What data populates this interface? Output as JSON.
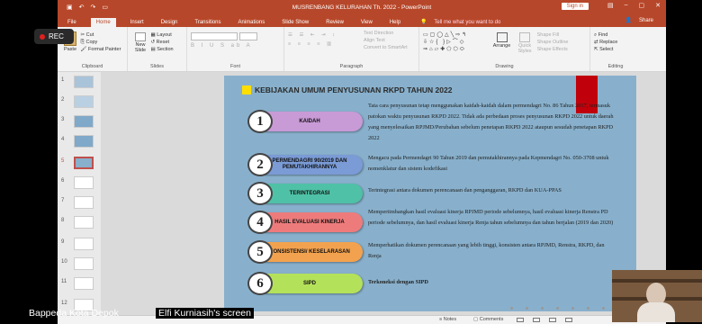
{
  "recording": {
    "label": "REC"
  },
  "titlebar": {
    "title": "MUSRENBANG KELURAHAN Th. 2022  -  PowerPoint",
    "signin": "Sign in"
  },
  "tabs": [
    "File",
    "Home",
    "Insert",
    "Design",
    "Transitions",
    "Animations",
    "Slide Show",
    "Review",
    "View",
    "Help"
  ],
  "tell_me": "Tell me what you want to do",
  "share": "Share",
  "ribbon": {
    "clipboard": {
      "label": "Clipboard",
      "paste": "Paste",
      "cut": "Cut",
      "copy": "Copy",
      "format_painter": "Format Painter"
    },
    "slides": {
      "label": "Slides",
      "new_slide": "New Slide",
      "layout": "Layout",
      "reset": "Reset",
      "section": "Section"
    },
    "font": {
      "label": "Font"
    },
    "paragraph": {
      "label": "Paragraph",
      "text_direction": "Text Direction",
      "align_text": "Align Text",
      "convert": "Convert to SmartArt"
    },
    "drawing": {
      "label": "Drawing",
      "arrange": "Arrange",
      "quick_styles": "Quick Styles",
      "shape_fill": "Shape Fill",
      "shape_outline": "Shape Outline",
      "shape_effects": "Shape Effects"
    },
    "editing": {
      "label": "Editing",
      "find": "Find",
      "replace": "Replace",
      "select": "Select"
    }
  },
  "thumbnails": [
    "1",
    "2",
    "3",
    "4",
    "5",
    "6",
    "7",
    "8",
    "9",
    "10",
    "11",
    "12"
  ],
  "slide": {
    "title": "KEBIJAKAN UMUM PENYUSUNAN RKPD TAHUN 2022",
    "items": [
      {
        "num": "1",
        "label": "KAIDAH",
        "color": "#c89ad6",
        "desc": "Tata cara penyusunan tetap menggunakan kaidah-kaidah dalam permendagri No. 86 Tahun 2017, termasuk patokan waktu penyusunan RKPD 2022. Tidak ada perbedaan proses penyusunan RKPD 2022 untuk daerah yang menyelesaikan RPJMD/Perubahan sebelum penetapan RKPD 2022 ataupun sesudah penetapan RKPD 2022"
      },
      {
        "num": "2",
        "label": "PERMENDAGRI 90/2019 DAN PEMUTAKHIRANNYA",
        "color": "#7a9bd6",
        "desc": "Mengacu pada Permendagri 90 Tahun 2019 dan pemutakhirannya pada Kepmendagri No. 050-3708 untuk nomenklatur dan sistem kodefikasi"
      },
      {
        "num": "3",
        "label": "TERINTEGRASI",
        "color": "#4fc1a6",
        "desc": "Terintegrasi antara dokumen perencanaan dan penganggaran, RKPD dan KUA-PPAS"
      },
      {
        "num": "4",
        "label": "HASIL EVALUASI KINERJA",
        "color": "#ee7b7b",
        "desc": "Mempertimbangkan hasil evaluasi kinerja RPJMD periode sebelumnya, hasil evaluasi kinerja Renstra PD periode sebelumnya, dan hasil evaluasi kinerja Renja tahun sebelumnya dan tahun berjalan (2019 dan 2020)"
      },
      {
        "num": "5",
        "label": "KONSISTENSI/ KESELARASAN",
        "color": "#f2a24f",
        "desc": "Memperhatikan dokumen perencanaan yang lebih tinggi, konsisten antara RPJMD, Renstra, RKPD, dan Renja"
      },
      {
        "num": "6",
        "label": "SIPD",
        "color": "#b4e15a",
        "desc": "Terkoneksi dengan SIPD"
      }
    ]
  },
  "statusbar": {
    "notes": "Notes",
    "comments": "Comments"
  },
  "caption": {
    "left": "Bappeda Kota Depok",
    "right": "Elfi Kurniasih's screen"
  }
}
